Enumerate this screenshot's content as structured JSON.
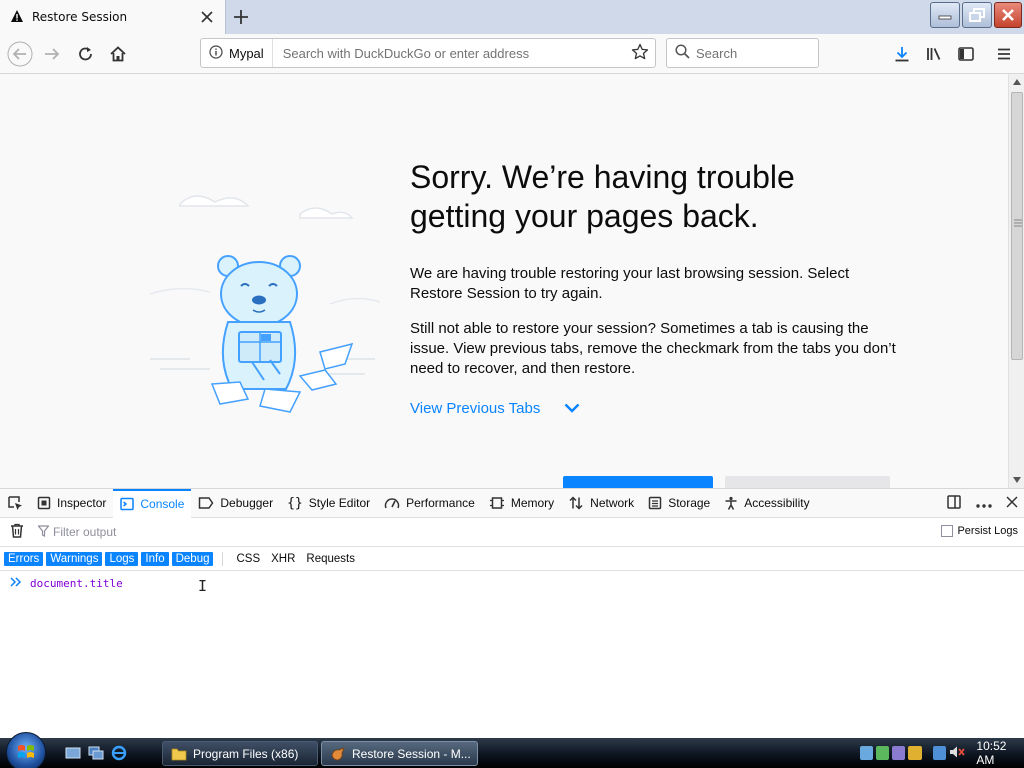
{
  "browser": {
    "tab_title": "Restore Session",
    "identity_label": "Mypal",
    "address_placeholder": "Search with DuckDuckGo or enter address",
    "search_placeholder": "Search"
  },
  "page": {
    "heading_line1": "Sorry. We’re having trouble",
    "heading_line2": "getting your pages back.",
    "para1": "We are having trouble restoring your last browsing session. Select Restore Session to try again.",
    "para2": "Still not able to restore your session? Sometimes a tab is causing the issue. View previous tabs, remove the checkmark from the tabs you don’t need to recover, and then restore.",
    "view_previous": "View Previous Tabs"
  },
  "devtools": {
    "tabs": [
      {
        "label": "Inspector",
        "icon": "inspector-icon"
      },
      {
        "label": "Console",
        "icon": "console-icon",
        "active": true
      },
      {
        "label": "Debugger",
        "icon": "debugger-icon"
      },
      {
        "label": "Style Editor",
        "icon": "style-editor-icon"
      },
      {
        "label": "Performance",
        "icon": "performance-icon"
      },
      {
        "label": "Memory",
        "icon": "memory-icon"
      },
      {
        "label": "Network",
        "icon": "network-icon"
      },
      {
        "label": "Storage",
        "icon": "storage-icon"
      },
      {
        "label": "Accessibility",
        "icon": "accessibility-icon"
      }
    ],
    "filter_placeholder": "Filter output",
    "persist_logs": "Persist Logs",
    "levels": [
      "Errors",
      "Warnings",
      "Logs",
      "Info",
      "Debug"
    ],
    "categories": [
      "CSS",
      "XHR",
      "Requests"
    ],
    "console_input": "document.title"
  },
  "taskbar": {
    "tasks": [
      "Program Files (x86)",
      "Restore Session - M..."
    ],
    "clock": "10:52 AM"
  },
  "colors": {
    "accent": "#0a84ff",
    "console_text": "#8000d7"
  }
}
